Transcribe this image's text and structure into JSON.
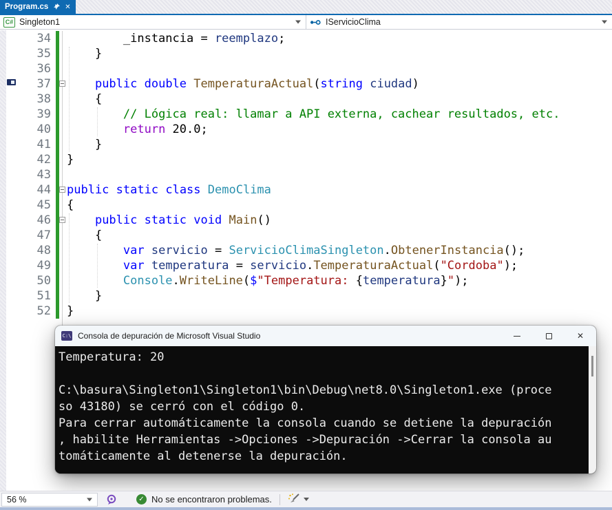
{
  "tab": {
    "title": "Program.cs"
  },
  "nav": {
    "project": "Singleton1",
    "member": "IServicioClima"
  },
  "icons": {
    "pin": "pin-icon",
    "close": "✕",
    "caret": "dropdown-caret",
    "csharp_project": "C#",
    "interface_glyph": "o-o",
    "console_cmd": "C:\\",
    "minimize": "–",
    "maximize": "□",
    "check": "✓"
  },
  "colors": {
    "tab_blue": "#0f6ab2",
    "change_bar_green": "#2c9a2c",
    "check_green": "#388a34",
    "feedback_purple": "#7a4bbf",
    "console_bg": "#0c0c0c",
    "keyword_blue": "#0000ff",
    "control_purple": "#8f08c4",
    "type_teal": "#2b91af",
    "method_brown": "#74531f",
    "local_navy": "#1f377f",
    "string_red": "#a31515",
    "comment_green": "#008000",
    "plain": "#010101"
  },
  "editor": {
    "colors": {
      "kw": "#0000ff",
      "ctrl": "#8f08c4",
      "cls": "#2b91af",
      "mth": "#74531f",
      "loc": "#1f377f",
      "str": "#a31515",
      "com": "#008000",
      "pln": "#010101"
    },
    "lines": [
      {
        "n": 34,
        "segs": [
          [
            "pln",
            "        _instancia = "
          ],
          [
            "loc",
            "reemplazo"
          ],
          [
            "pln",
            ";"
          ]
        ]
      },
      {
        "n": 35,
        "segs": [
          [
            "pln",
            "    }"
          ]
        ]
      },
      {
        "n": 36,
        "segs": []
      },
      {
        "n": 37,
        "fold": true,
        "segs": [
          [
            "pln",
            "    "
          ],
          [
            "kw",
            "public"
          ],
          [
            "pln",
            " "
          ],
          [
            "kw",
            "double"
          ],
          [
            "pln",
            " "
          ],
          [
            "mth",
            "TemperaturaActual"
          ],
          [
            "pln",
            "("
          ],
          [
            "kw",
            "string"
          ],
          [
            "pln",
            " "
          ],
          [
            "loc",
            "ciudad"
          ],
          [
            "pln",
            ")"
          ]
        ]
      },
      {
        "n": 38,
        "segs": [
          [
            "pln",
            "    {"
          ]
        ]
      },
      {
        "n": 39,
        "segs": [
          [
            "pln",
            "        "
          ],
          [
            "com",
            "// Lógica real: llamar a API externa, cachear resultados, etc."
          ]
        ]
      },
      {
        "n": 40,
        "segs": [
          [
            "pln",
            "        "
          ],
          [
            "ctrl",
            "return"
          ],
          [
            "pln",
            " 20.0;"
          ]
        ]
      },
      {
        "n": 41,
        "segs": [
          [
            "pln",
            "    }"
          ]
        ]
      },
      {
        "n": 42,
        "segs": [
          [
            "pln",
            "}"
          ]
        ]
      },
      {
        "n": 43,
        "segs": []
      },
      {
        "n": 44,
        "fold": true,
        "segs": [
          [
            "kw",
            "public"
          ],
          [
            "pln",
            " "
          ],
          [
            "kw",
            "static"
          ],
          [
            "pln",
            " "
          ],
          [
            "kw",
            "class"
          ],
          [
            "pln",
            " "
          ],
          [
            "cls",
            "DemoClima"
          ]
        ]
      },
      {
        "n": 45,
        "segs": [
          [
            "pln",
            "{"
          ]
        ]
      },
      {
        "n": 46,
        "fold": true,
        "segs": [
          [
            "pln",
            "    "
          ],
          [
            "kw",
            "public"
          ],
          [
            "pln",
            " "
          ],
          [
            "kw",
            "static"
          ],
          [
            "pln",
            " "
          ],
          [
            "kw",
            "void"
          ],
          [
            "pln",
            " "
          ],
          [
            "mth",
            "Main"
          ],
          [
            "pln",
            "()"
          ]
        ]
      },
      {
        "n": 47,
        "segs": [
          [
            "pln",
            "    {"
          ]
        ]
      },
      {
        "n": 48,
        "segs": [
          [
            "pln",
            "        "
          ],
          [
            "kw",
            "var"
          ],
          [
            "pln",
            " "
          ],
          [
            "loc",
            "servicio"
          ],
          [
            "pln",
            " = "
          ],
          [
            "cls",
            "ServicioClimaSingleton"
          ],
          [
            "pln",
            "."
          ],
          [
            "mth",
            "ObtenerInstancia"
          ],
          [
            "pln",
            "();"
          ]
        ]
      },
      {
        "n": 49,
        "segs": [
          [
            "pln",
            "        "
          ],
          [
            "kw",
            "var"
          ],
          [
            "pln",
            " "
          ],
          [
            "loc",
            "temperatura"
          ],
          [
            "pln",
            " = "
          ],
          [
            "loc",
            "servicio"
          ],
          [
            "pln",
            "."
          ],
          [
            "mth",
            "TemperaturaActual"
          ],
          [
            "pln",
            "("
          ],
          [
            "str",
            "\"Cordoba\""
          ],
          [
            "pln",
            ");"
          ]
        ]
      },
      {
        "n": 50,
        "segs": [
          [
            "pln",
            "        "
          ],
          [
            "cls",
            "Console"
          ],
          [
            "pln",
            "."
          ],
          [
            "mth",
            "WriteLine"
          ],
          [
            "pln",
            "("
          ],
          [
            "kw",
            "$"
          ],
          [
            "str",
            "\"Temperatura: "
          ],
          [
            "pln",
            "{"
          ],
          [
            "loc",
            "temperatura"
          ],
          [
            "pln",
            "}"
          ],
          [
            "str",
            "\""
          ],
          [
            "pln",
            ");"
          ]
        ]
      },
      {
        "n": 51,
        "segs": [
          [
            "pln",
            "    }"
          ]
        ]
      },
      {
        "n": 52,
        "segs": [
          [
            "pln",
            "}"
          ]
        ]
      }
    ]
  },
  "console": {
    "title": "Consola de depuración de Microsoft Visual Studio",
    "lines": [
      "Temperatura: 20",
      "",
      "C:\\basura\\Singleton1\\Singleton1\\bin\\Debug\\net8.0\\Singleton1.exe (proce",
      "so 43180) se cerró con el código 0.",
      "Para cerrar automáticamente la consola cuando se detiene la depuración",
      ", habilite Herramientas ->Opciones ->Depuración ->Cerrar la consola au",
      "tomáticamente al detenerse la depuración."
    ]
  },
  "status": {
    "zoom_level": "56 %",
    "message": "No se encontraron problemas."
  }
}
